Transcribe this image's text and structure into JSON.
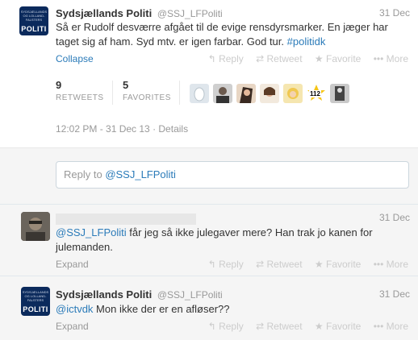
{
  "tweet1": {
    "name": "Sydsjællands Politi",
    "handle": "@SSJ_LFPoliti",
    "date": "31 Dec",
    "text_main": "Så er Rudolf desværre afgået til de evige rensdyrsmarker. En jæger har taget sig af ham. Syd mtv. er igen farbar. God tur. ",
    "hashtag": "#politidk",
    "collapse_label": "Collapse",
    "actions": {
      "reply": "Reply",
      "retweet": "Retweet",
      "favorite": "Favorite",
      "more": "More"
    },
    "retweets_count": "9",
    "retweets_label": "RETWEETS",
    "favorites_count": "5",
    "favorites_label": "FAVORITES",
    "timestamp": "12:02 PM - 31 Dec 13 · Details"
  },
  "reply_box": {
    "prefix": "Reply to ",
    "mention": "@SSJ_LFPoliti"
  },
  "tweet2": {
    "date": "31 Dec",
    "mention": "@SSJ_LFPoliti",
    "text": " får jeg så ikke julegaver mere? Han trak jo kanen for julemanden.",
    "expand_label": "Expand",
    "actions": {
      "reply": "Reply",
      "retweet": "Retweet",
      "favorite": "Favorite",
      "more": "More"
    }
  },
  "tweet3": {
    "name": "Sydsjællands Politi",
    "handle": "@SSJ_LFPoliti",
    "date": "31 Dec",
    "mention": "@ictvdk",
    "text": " Mon ikke der er en afløser??",
    "expand_label": "Expand",
    "actions": {
      "reply": "Reply",
      "retweet": "Retweet",
      "favorite": "Favorite",
      "more": "More"
    }
  },
  "avatar_logo": {
    "word": "POLITI",
    "crest": "SYDSJÆLLANDS OG LOLLAND-FALSTERS"
  },
  "favoriter_badge": "112",
  "colors": {
    "link": "#2b7bb9",
    "politi_blue": "#0b2a5c",
    "muted": "#999999"
  }
}
